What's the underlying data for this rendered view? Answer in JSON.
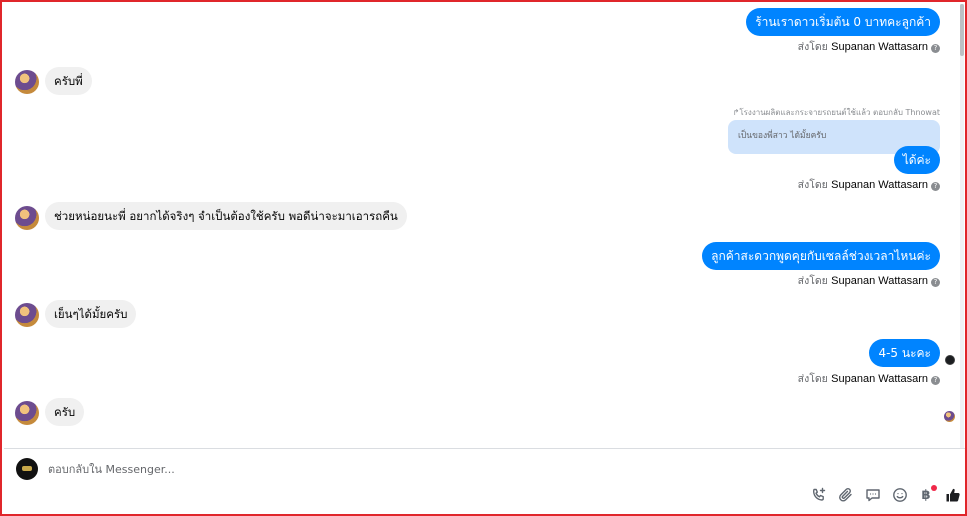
{
  "messages": {
    "m1": {
      "text": "ร้านเราดาวเริ่มต้น 0 บาทคะลูกค้า"
    },
    "m1_sent": {
      "prefix": "ส่งโดย",
      "name": "Supanan Wattasarn"
    },
    "m2": {
      "text": "ครับพี่"
    },
    "m3_reply_label": "↱โรงงานผลิตและกระจายรถยนต์ใช้แล้ว ตอบกลับ Thnowat",
    "m3_quote": "เป็นของพี่สาว ได้มั้ยครับ",
    "m3": {
      "text": "ได้ค่ะ"
    },
    "m3_sent": {
      "prefix": "ส่งโดย",
      "name": "Supanan Wattasarn"
    },
    "m4": {
      "text": "ช่วยหน่อยนะพี่ อยากได้จริงๆ จำเป็นต้องใช้ครับ พอดีน่าจะมาเอารถคืน"
    },
    "m5": {
      "text": "ลูกค้าสะดวกพูดคุยกับเซลล์ช่วงเวลาไหนค่ะ"
    },
    "m5_sent": {
      "prefix": "ส่งโดย",
      "name": "Supanan Wattasarn"
    },
    "m6": {
      "text": "เย็นๆได้มั้ยครับ"
    },
    "m7": {
      "text": "4-5 นะคะ"
    },
    "m7_sent": {
      "prefix": "ส่งโดย",
      "name": "Supanan Wattasarn"
    },
    "m8": {
      "text": "ครับ"
    }
  },
  "composer": {
    "placeholder": "ตอบกลับใน Messenger...",
    "baht_symbol": "฿"
  },
  "icons": {
    "info": "info-icon",
    "call": "phone-plus-icon",
    "attach": "paperclip-icon",
    "saved_replies": "chat-bubble-icon",
    "emoji": "smiley-icon",
    "payment": "baht-icon",
    "like": "thumbs-up-icon"
  },
  "colors": {
    "outgoing_bubble": "#0084ff",
    "incoming_bubble": "#f0f0f0",
    "reply_quote": "#cfe3fb",
    "frame_border": "#e0262b"
  }
}
